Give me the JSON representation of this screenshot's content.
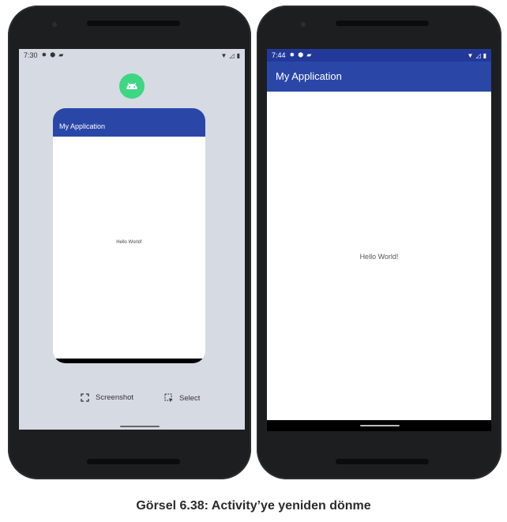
{
  "left_phone": {
    "status": {
      "time": "7:30"
    },
    "recents_card": {
      "app_title": "My Application",
      "body_text": "Hello World!"
    },
    "actions": {
      "screenshot_label": "Screenshot",
      "select_label": "Select"
    }
  },
  "right_phone": {
    "status": {
      "time": "7:44"
    },
    "app_bar_title": "My Application",
    "body_text": "Hello World!"
  },
  "caption": "Görsel 6.38: Activity’ye yeniden dönme",
  "colors": {
    "app_bar": "#2a47a8",
    "status_bar_dark": "#22399a",
    "recents_bg": "#d6dae3",
    "android_icon_bg": "#3dd683"
  },
  "icons": {
    "status_left": [
      "gear-icon",
      "shield-icon",
      "sd-card-icon"
    ],
    "status_right": [
      "wifi-icon",
      "signal-icon",
      "battery-icon"
    ],
    "actions": [
      "screenshot-icon",
      "select-icon"
    ],
    "app_icon": "android-icon"
  }
}
